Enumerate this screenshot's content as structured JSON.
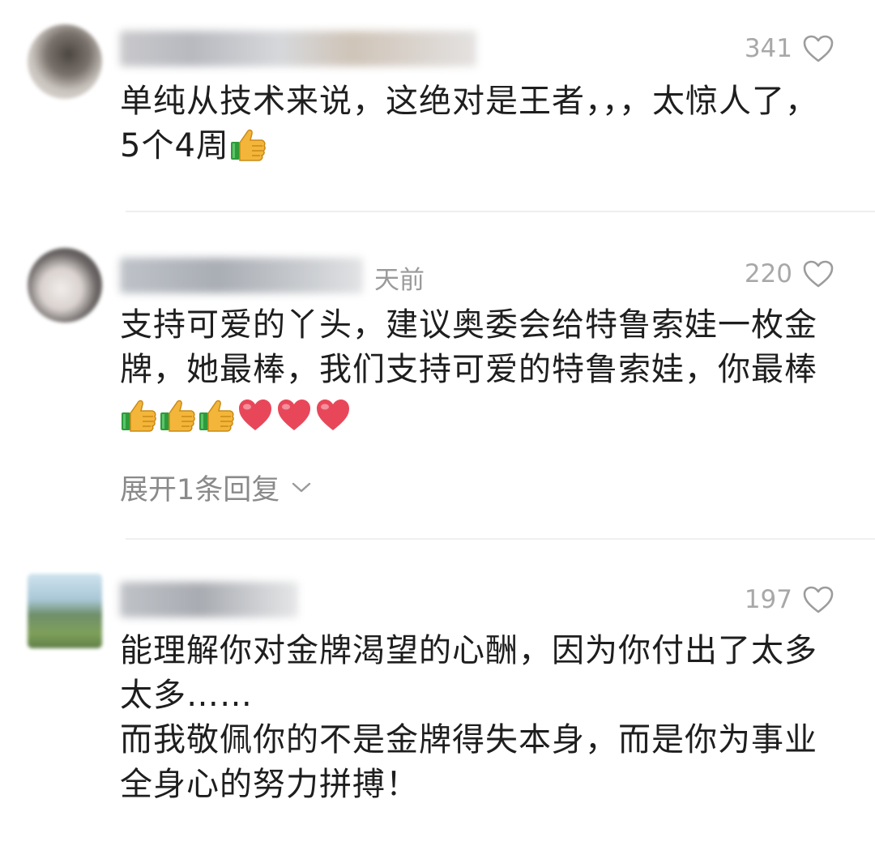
{
  "comments": [
    {
      "likes": "341",
      "time": "",
      "lines": [
        "单纯从技术来说，这绝对是王者，，，太惊人了，",
        "5个4周"
      ],
      "emoji": [
        "thumbs-up"
      ]
    },
    {
      "likes": "220",
      "time": "天前",
      "lines": [
        "支持可爱的丫头，建议奥委会给特鲁索娃一枚金",
        "牌，她最棒，我们支持可爱的特鲁索娃，你最棒"
      ],
      "emoji": [
        "thumbs-up",
        "thumbs-up",
        "thumbs-up",
        "red-heart",
        "red-heart",
        "red-heart"
      ],
      "expand_label": "展开1条回复"
    },
    {
      "likes": "197",
      "time": "",
      "lines": [
        "能理解你对金牌渴望的心酬，因为你付出了太多",
        "太多……",
        "而我敬佩你的不是金牌得失本身，而是你为事业",
        "全身心的努力拼搏！"
      ]
    }
  ],
  "colors": {
    "like_count": "#a8a8a8",
    "content_text": "#1e1e1e",
    "expand_text": "#8a8a8a",
    "divider": "#efefef",
    "heart_red": "#e8475a",
    "thumb_yellow": "#f4b63a",
    "thumb_cuff": "#2e9b3a"
  }
}
